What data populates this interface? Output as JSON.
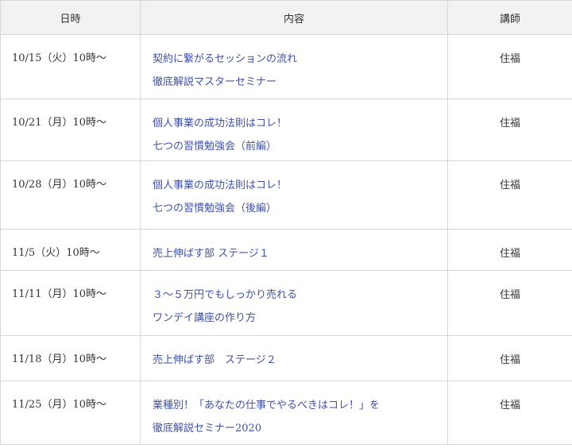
{
  "header": {
    "date": "日時",
    "content": "内容",
    "teacher": "講師"
  },
  "rows": [
    {
      "date": "10/15（火）10時〜",
      "line1": "契約に繋がるセッションの流れ",
      "line2": "徹底解説マスターセミナー",
      "teacher": "住福"
    },
    {
      "date": "10/21（月）10時〜",
      "line1": "個人事業の成功法則はコレ！",
      "line2": "七つの習慣勉強会（前編）",
      "teacher": "住福"
    },
    {
      "date": "10/28（月）10時〜",
      "line1": "個人事業の成功法則はコレ！",
      "line2": "七つの習慣勉強会（後編）",
      "teacher": "住福"
    },
    {
      "date": "11/5（火）10時〜",
      "line1": "売上伸ばす部 ステージ１",
      "line2": "",
      "teacher": "住福"
    },
    {
      "date": "11/11（月）10時〜",
      "line1": "３〜５万円でもしっかり売れる",
      "line2": "ワンデイ講座の作り方",
      "teacher": "住福"
    },
    {
      "date": "11/18（月）10時〜",
      "line1": "売上伸ばす部　ステージ２",
      "line2": "",
      "teacher": "住福"
    },
    {
      "date": "11/25（月）10時〜",
      "line1": "業種別！「あなたの仕事でやるべきはコレ！」を",
      "line2": "徹底解説セミナー2020",
      "teacher": "住福"
    }
  ]
}
